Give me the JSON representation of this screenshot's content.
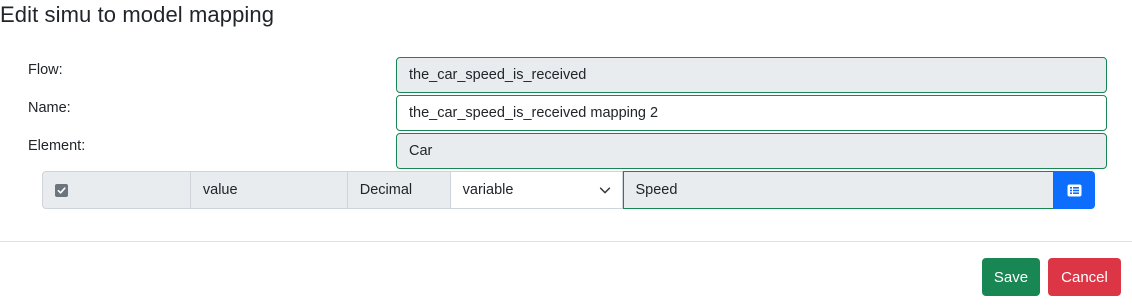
{
  "dialog": {
    "title": "Edit simu to model mapping"
  },
  "form": {
    "flow_label": "Flow:",
    "flow_value": "the_car_speed_is_received",
    "name_label": "Name:",
    "name_value": "the_car_speed_is_received mapping 2",
    "element_label": "Element:",
    "element_value": "Car"
  },
  "mapping_row": {
    "checked": true,
    "attribute": "value",
    "type": "Decimal",
    "kind_selected": "variable",
    "target_value": "Speed",
    "list_button_icon": "list-icon"
  },
  "footer": {
    "save_label": "Save",
    "cancel_label": "Cancel"
  },
  "colors": {
    "valid_border": "#198754",
    "primary": "#0d6efd",
    "success": "#198754",
    "danger": "#dc3545",
    "readonly_bg": "#e9ecef"
  }
}
